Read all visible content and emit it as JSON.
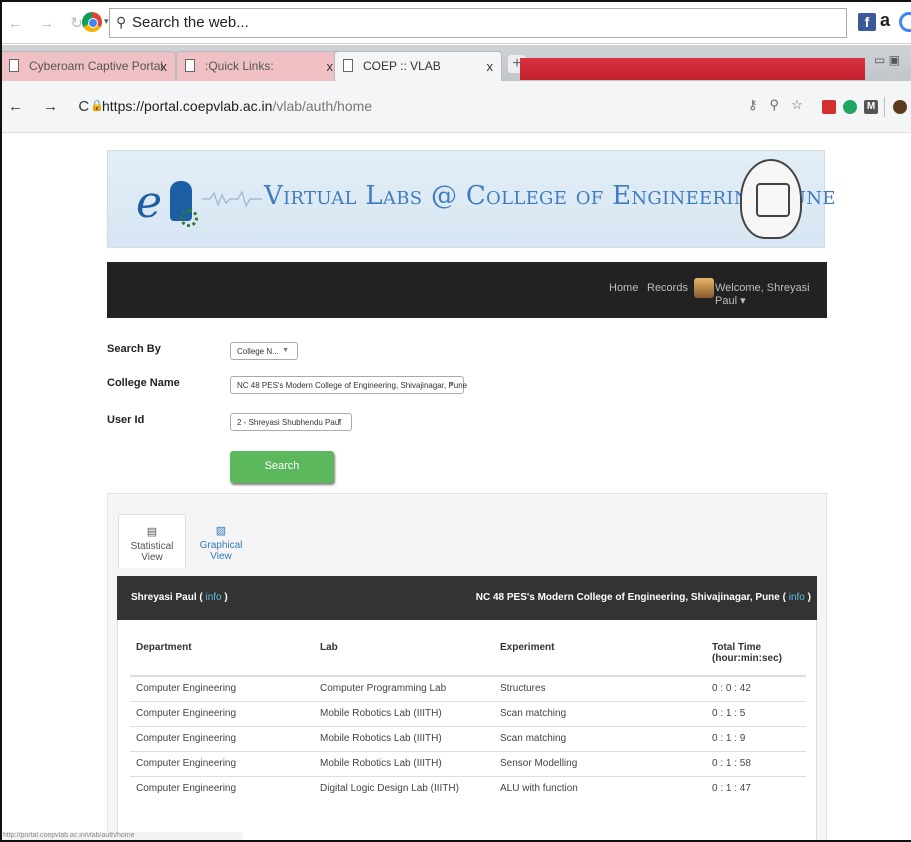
{
  "browser": {
    "search_placeholder": "Search the web...",
    "tabs": [
      {
        "label": "Cyberoam Captive Portal",
        "close": "x"
      },
      {
        "label": ":Quick Links:",
        "close": "x"
      },
      {
        "label": "COEP :: VLAB",
        "close": "x"
      }
    ],
    "new_tab": "+",
    "url_host": "https://portal.coepvlab.ac.in",
    "url_path": "/vlab/auth/home",
    "status_url": "http://portal.coepvlab.ac.in/vlab/auth/home"
  },
  "banner": {
    "title": "Virtual Labs @ College of Engineering Pune"
  },
  "nav": {
    "home": "Home",
    "records": "Records",
    "welcome": "Welcome, Shreyasi Paul ▾"
  },
  "form": {
    "search_by_label": "Search By",
    "search_by_value": "College N...",
    "college_label": "College Name",
    "college_value": "NC 48 PES's Modern College of Engineering, Shivajinagar, Pune",
    "user_label": "User Id",
    "user_value": "2 - Shreyasi Shubhendu Paul",
    "search_button": "Search"
  },
  "views": {
    "statistical": "Statistical View",
    "graphical": "Graphical View"
  },
  "card": {
    "user_name": "Shreyasi Paul (",
    "info": "info",
    "close_paren": ")",
    "college": "NC 48 PES's Modern College of Engineering, Shivajinagar, Pune ("
  },
  "table": {
    "headers": [
      "Department",
      "Lab",
      "Experiment",
      "Total Time",
      "(hour:min:sec)"
    ],
    "rows": [
      [
        "Computer Engineering",
        "Computer Programming Lab",
        "Structures",
        "0 : 0 : 42"
      ],
      [
        "Computer Engineering",
        "Mobile Robotics Lab (IIITH)",
        "Scan matching",
        "0 : 1 : 5"
      ],
      [
        "Computer Engineering",
        "Mobile Robotics Lab (IIITH)",
        "Scan matching",
        "0 : 1 : 9"
      ],
      [
        "Computer Engineering",
        "Mobile Robotics Lab (IIITH)",
        "Sensor Modelling",
        "0 : 1 : 58"
      ],
      [
        "Computer Engineering",
        "Digital Logic Design Lab (IIITH)",
        "ALU with function",
        "0 : 1 : 47"
      ]
    ]
  },
  "colors": {
    "navbar": "#222222",
    "search_button": "#5cb85c",
    "info_link": "#5bc0de",
    "banner_title": "#3f7dc0"
  }
}
